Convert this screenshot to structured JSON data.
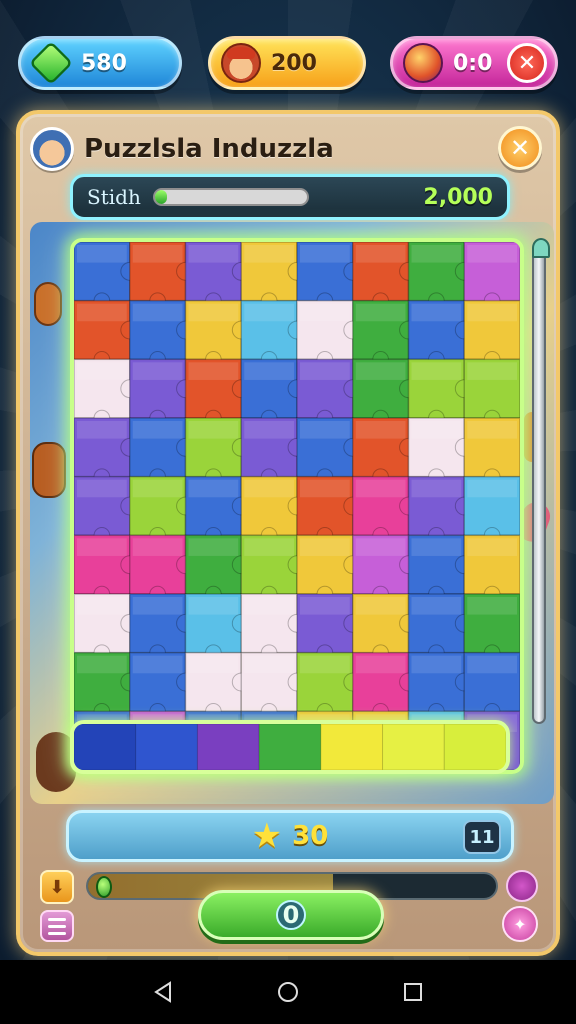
{
  "top_bar": {
    "gems": {
      "value": "580",
      "icon": "gem-icon"
    },
    "coins": {
      "value": "200",
      "icon": "chef-icon"
    },
    "lives": {
      "value": "0:0",
      "icon": "heart-ball-icon"
    },
    "close_label": "✕"
  },
  "panel": {
    "title": "Puzzlsla Induzzla",
    "close_label": "✕",
    "score": {
      "label": "Stidh",
      "progress": 0.08,
      "value": "2,000"
    }
  },
  "board": {
    "rows": 9,
    "cols": 8,
    "palette": [
      "#3fae3f",
      "#7a5bd4",
      "#f0c83a",
      "#e8409a",
      "#3a6fd6",
      "#e2542a",
      "#f5e6ee",
      "#5ac0e8",
      "#c65fd8",
      "#9ad43a"
    ]
  },
  "stars_bar": {
    "icon": "star-icon",
    "value": "30",
    "level": "11"
  },
  "controls": {
    "down_label": "⬇",
    "progress": 0.6,
    "play_value": "0",
    "purple_bottom_label": "✦"
  },
  "colors": {
    "panel_border": "#f3c86a",
    "board_glow": "#c8ff8a",
    "score_value": "#b5ff59"
  }
}
